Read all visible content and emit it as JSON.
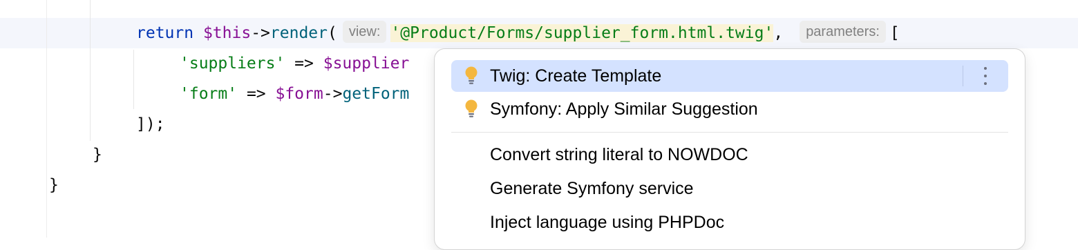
{
  "code": {
    "line1": {
      "kw": "return",
      "this": "$this",
      "arrow": "->",
      "fn": "render",
      "paren": "(",
      "hint_view": "view:",
      "template": "'@Product/Forms/supplier_form.html.twig'",
      "comma": ",",
      "hint_params": "parameters:",
      "bracket": "["
    },
    "line2": {
      "key": "'suppliers'",
      "op": " => ",
      "var": "$supplier"
    },
    "line3": {
      "key": "'form'",
      "op": " => ",
      "var": "$form",
      "arrow": "->",
      "fn": "getForm"
    },
    "line4": {
      "text": "]);"
    },
    "line5": {
      "text": "}"
    },
    "line6": {
      "text": "}"
    }
  },
  "popup": {
    "items": [
      {
        "label": "Twig: Create Template",
        "icon": "lightbulb-icon",
        "selected": true
      },
      {
        "label": "Symfony: Apply Similar Suggestion",
        "icon": "lightbulb-icon",
        "selected": false
      },
      {
        "label": "Convert string literal to NOWDOC"
      },
      {
        "label": "Generate Symfony service"
      },
      {
        "label": "Inject language using PHPDoc"
      }
    ],
    "more_icon": "more-vertical-icon"
  },
  "colors": {
    "selection": "#d4e2ff",
    "bulb": "#f4b73f",
    "caret_row": "#f4f6fc"
  }
}
